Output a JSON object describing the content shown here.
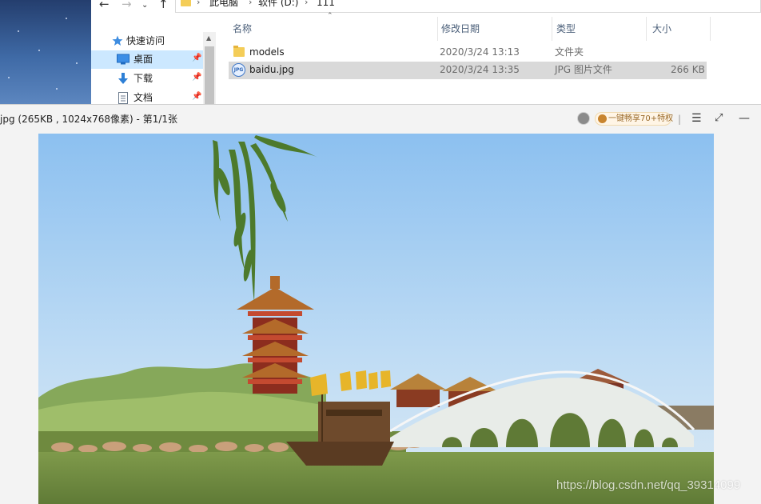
{
  "explorer": {
    "breadcrumb": [
      "此电脑",
      "软件 (D:)",
      "111"
    ],
    "nav": {
      "items": [
        {
          "label": "快速访问",
          "icon": "star-icon"
        },
        {
          "label": "桌面",
          "icon": "desktop-icon",
          "selected": true
        },
        {
          "label": "下载",
          "icon": "download-arrow-icon"
        },
        {
          "label": "文档",
          "icon": "document-icon"
        }
      ]
    },
    "columns": {
      "name": "名称",
      "date": "修改日期",
      "type": "类型",
      "size": "大小"
    },
    "files": [
      {
        "name": "models",
        "date": "2020/3/24 13:13",
        "type": "文件夹",
        "size": "",
        "icon": "folder-icon"
      },
      {
        "name": "baidu.jpg",
        "date": "2020/3/24 13:35",
        "type": "JPG 图片文件",
        "size": "266 KB",
        "icon": "jpg-file-icon",
        "selected": true
      }
    ]
  },
  "viewer": {
    "title": "jpg (265KB , 1024x768像素) - 第1/1张",
    "promo": "一键畅享70+特权",
    "menu_icon": "hamburger-menu-icon",
    "fullscreen_icon": "fullscreen-icon",
    "minimize_icon": "minimize-icon"
  },
  "watermark": "https://blog.csdn.net/qq_39314099",
  "colors": {
    "selection_nav": "#cce8ff",
    "selection_row": "#d9d9d9",
    "viewer_bg": "#f3f3f3",
    "sky": "#a9cff3",
    "water": "#6f8a3f"
  }
}
